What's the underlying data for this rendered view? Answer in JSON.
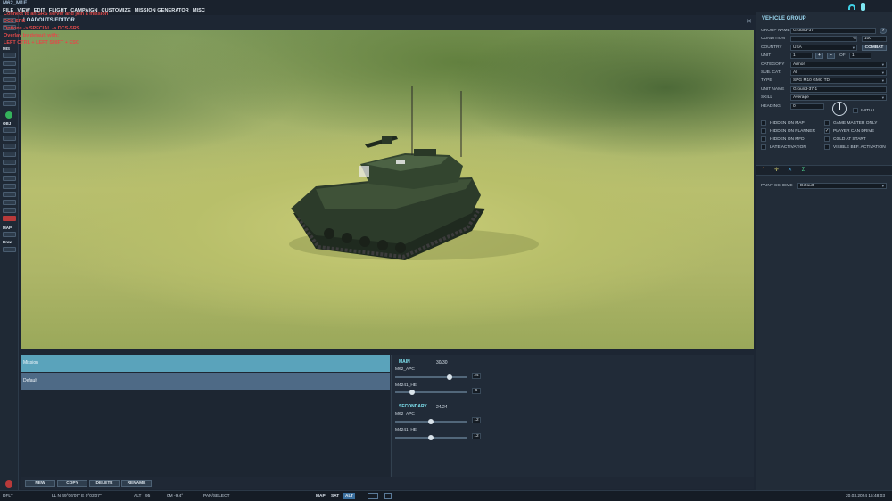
{
  "app": {
    "file_name": "M62_M1E",
    "menu": [
      "FILE",
      "VIEW",
      "EDIT",
      "FLIGHT",
      "CAMPAIGN",
      "CUSTOMIZE",
      "MISSION GENERATOR",
      "MISC"
    ],
    "editor_title": "LOADOUTS EDITOR",
    "srs_lines": [
      "Connect to an SRS server and join a mission",
      "DCS SRS",
      "Options -> SPECIAL -> DCS-SRS",
      "Overlay by default with:",
      "LEFT CTRL + LEFT SHIFT + ESC"
    ]
  },
  "toolbar": {
    "mis_label": "MIS",
    "obj_label": "OBJ",
    "map_label": "MAP",
    "draw_label": "Draw"
  },
  "vehicle_group": {
    "title": "VEHICLE GROUP",
    "labels": {
      "group_name": "GROUP NAME",
      "condition": "CONDITION",
      "country": "COUNTRY",
      "unit": "UNIT",
      "category": "CATEGORY",
      "sub_cat": "SUB. CAT.",
      "type": "TYPE",
      "unit_name": "UNIT NAME",
      "skill": "SKILL",
      "heading": "HEADING",
      "paint_scheme": "PAINT SCHEME"
    },
    "group_name": "Ground-37",
    "condition_pct": "%",
    "condition": "100",
    "country": "USA",
    "combat_label": "COMBAT",
    "unit_index": "1",
    "unit_of": "OF",
    "unit_total": "1",
    "category": "Armor",
    "sub_cat": "All",
    "type": "SPG M10 GMC TD",
    "unit_name": "Ground-37-1",
    "skill": "Average",
    "heading": "0",
    "initial_label": "INITIAL",
    "checkboxes": [
      {
        "label": "HIDDEN ON MAP",
        "checked": false
      },
      {
        "label": "GAME MASTER ONLY",
        "checked": false
      },
      {
        "label": "HIDDEN ON PLANNER",
        "checked": false
      },
      {
        "label": "PLAYER CAN DRIVE",
        "checked": true
      },
      {
        "label": "HIDDEN ON MFD",
        "checked": false
      },
      {
        "label": "COLD AT START",
        "checked": false
      },
      {
        "label": "LATE ACTIVATION",
        "checked": false
      },
      {
        "label": "VISIBLE BEF. ACTIVATION",
        "checked": false
      }
    ],
    "paint_scheme": "Default"
  },
  "loadouts": {
    "rows": [
      "Mission",
      "Default"
    ],
    "main_label": "MAIN",
    "main_count": "30/30",
    "secondary_label": "SECONDARY",
    "secondary_count": "24/24",
    "main_weapons": [
      {
        "name": "M62_APC",
        "qty": "24",
        "level": 0.78
      },
      {
        "name": "M4241_HE",
        "qty": "6",
        "level": 0.22
      }
    ],
    "secondary_weapons": [
      {
        "name": "M62_APC",
        "qty": "12",
        "level": 0.5
      },
      {
        "name": "M4241_HE",
        "qty": "12",
        "level": 0.5
      }
    ],
    "buttons": [
      "NEW",
      "COPY",
      "DELETE",
      "RENAME"
    ]
  },
  "status": {
    "profile": "DFLT",
    "coords": "LL  N 49°06'09\"  E  0°03'07\"",
    "alt_label": "ALT",
    "alt": "95",
    "bm": "0M  -9.4°",
    "mode": "PAN/SELECT",
    "map_btn": "MAP",
    "sat_btn": "SAT",
    "alt_btn": "ALT",
    "datetime": "20.03.2024  15:48:03"
  }
}
